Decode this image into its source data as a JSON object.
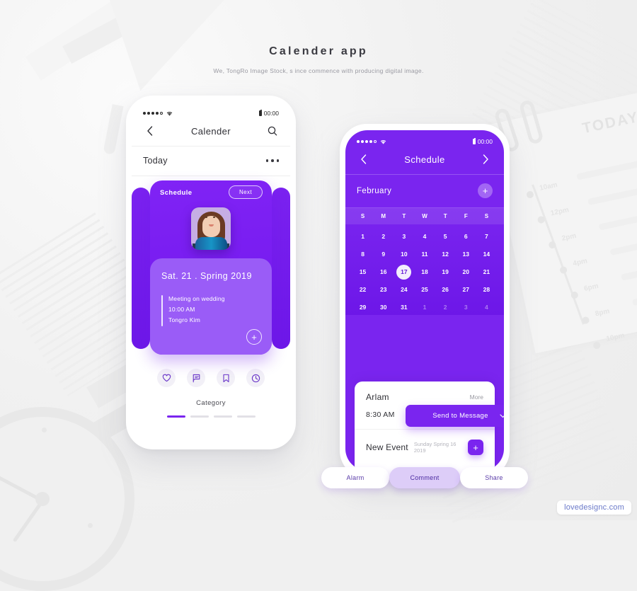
{
  "heading": {
    "title": "Calender app",
    "subtitle": "We, TongRo Image Stock, s ince commence with producing  digital image."
  },
  "background": {
    "note_title": "TODAY",
    "timeline": [
      "10am",
      "12pm",
      "2pm",
      "4pm",
      "6pm",
      "8pm",
      "10pm"
    ]
  },
  "phone1": {
    "status": {
      "time": "00:00"
    },
    "nav": {
      "back_icon": "chevron-left-icon",
      "title": "Calender",
      "search_icon": "search-icon"
    },
    "today_row": {
      "label": "Today",
      "menu_icon": "more-horizontal-icon"
    },
    "card": {
      "title": "Schedule",
      "next_label": "Next",
      "date": "Sat. 21 . Spring 2019",
      "event_title": "Meeting on wedding",
      "event_time": "10:00 AM",
      "event_person": "Tongro Kim",
      "add_label": "+"
    },
    "actions": [
      {
        "name": "heart-icon",
        "label": "Favorite"
      },
      {
        "name": "comment-icon",
        "label": "Comment"
      },
      {
        "name": "bookmark-icon",
        "label": "Bookmark"
      },
      {
        "name": "clock-icon",
        "label": "Time"
      }
    ],
    "category_label": "Category",
    "pager": {
      "count": 4,
      "active": 0
    }
  },
  "phone2": {
    "status": {
      "time": "00:00"
    },
    "nav": {
      "prev_icon": "chevron-left-icon",
      "title": "Schedule",
      "next_icon": "chevron-right-icon"
    },
    "month_row": {
      "label": "February",
      "add_label": "+"
    },
    "calendar": {
      "weekdays": [
        "S",
        "M",
        "T",
        "W",
        "T",
        "F",
        "S"
      ],
      "weeks": [
        [
          {
            "d": "1",
            "state": "in"
          },
          {
            "d": "2",
            "state": "in"
          },
          {
            "d": "3",
            "state": "in"
          },
          {
            "d": "4",
            "state": "in"
          },
          {
            "d": "5",
            "state": "in"
          },
          {
            "d": "6",
            "state": "in"
          },
          {
            "d": "7",
            "state": "in"
          }
        ],
        [
          {
            "d": "8",
            "state": "in"
          },
          {
            "d": "9",
            "state": "in"
          },
          {
            "d": "10",
            "state": "in"
          },
          {
            "d": "11",
            "state": "in"
          },
          {
            "d": "12",
            "state": "in"
          },
          {
            "d": "13",
            "state": "in"
          },
          {
            "d": "14",
            "state": "in"
          }
        ],
        [
          {
            "d": "15",
            "state": "in"
          },
          {
            "d": "16",
            "state": "in"
          },
          {
            "d": "17",
            "state": "selected"
          },
          {
            "d": "18",
            "state": "in"
          },
          {
            "d": "19",
            "state": "in"
          },
          {
            "d": "20",
            "state": "in"
          },
          {
            "d": "21",
            "state": "in"
          }
        ],
        [
          {
            "d": "22",
            "state": "in"
          },
          {
            "d": "23",
            "state": "in"
          },
          {
            "d": "24",
            "state": "in"
          },
          {
            "d": "25",
            "state": "in"
          },
          {
            "d": "26",
            "state": "in"
          },
          {
            "d": "27",
            "state": "in"
          },
          {
            "d": "28",
            "state": "in"
          }
        ],
        [
          {
            "d": "29",
            "state": "in"
          },
          {
            "d": "30",
            "state": "in"
          },
          {
            "d": "31",
            "state": "in"
          },
          {
            "d": "1",
            "state": "out"
          },
          {
            "d": "2",
            "state": "out"
          },
          {
            "d": "3",
            "state": "out"
          },
          {
            "d": "4",
            "state": "out"
          }
        ]
      ],
      "selected_day": "17"
    },
    "pills": [
      {
        "label": "Alarm",
        "style": "a"
      },
      {
        "label": "Comment",
        "style": "b"
      },
      {
        "label": "Share",
        "style": "c"
      }
    ],
    "sheet": {
      "title": "Arlam",
      "more_label": "More",
      "time": "8:30 AM",
      "send_label": "Send to Message",
      "send_chevron": "chevron-down-icon",
      "new_event_title": "New Event",
      "new_event_date": "Sunday Spring 16 2019",
      "new_event_add": "+"
    }
  },
  "watermark": "lovedesignc.com",
  "colors": {
    "accent": "#7a25ef",
    "accent_light": "#9a5cf7",
    "pill_light": "#ddcdf8",
    "page_bg": "#f0f0f0",
    "text_dark": "#2f2f35"
  }
}
